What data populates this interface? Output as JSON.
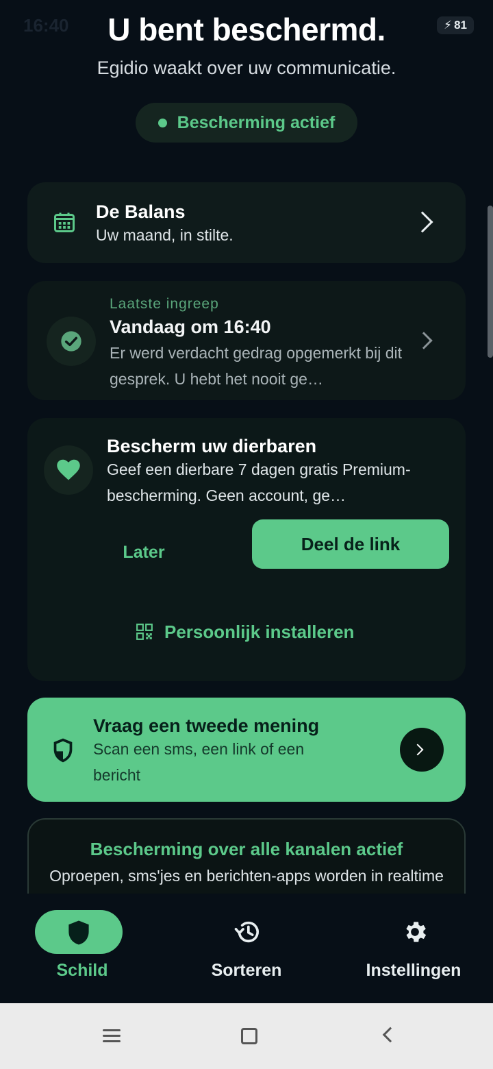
{
  "status_bar": {
    "time": "16:40",
    "battery": "81"
  },
  "header": {
    "title": "U bent beschermd.",
    "subtitle": "Egidio waakt over uw communicatie.",
    "status_pill": "Bescherming actief"
  },
  "balans": {
    "title": "De Balans",
    "subtitle": "Uw maand, in stilte."
  },
  "last_action": {
    "label": "Laatste ingreep",
    "title": "Vandaag om 16:40",
    "description": "Er werd verdacht gedrag opgemerkt bij dit gesprek. U hebt het nooit ge…"
  },
  "loved_ones": {
    "title": "Bescherm uw dierbaren",
    "description": "Geef een dierbare 7 dagen gratis Premium-bescherming. Geen account, ge…",
    "later_label": "Later",
    "share_label": "Deel de link",
    "install_label": "Persoonlijk installeren"
  },
  "second_opinion": {
    "title": "Vraag een tweede mening",
    "description": "Scan een sms, een link of een bericht"
  },
  "channels": {
    "title": "Bescherming over alle kanalen actief",
    "description": "Oproepen, sms'jes en berichten-apps worden in realtime gescand."
  },
  "bottom_nav": {
    "items": [
      {
        "label": "Schild",
        "icon": "shield-icon",
        "active": true
      },
      {
        "label": "Sorteren",
        "icon": "history-icon",
        "active": false
      },
      {
        "label": "Instellingen",
        "icon": "gear-icon",
        "active": false
      }
    ]
  },
  "colors": {
    "accent": "#5cc98a",
    "background": "#070f17",
    "card": "#0e1a1a"
  }
}
